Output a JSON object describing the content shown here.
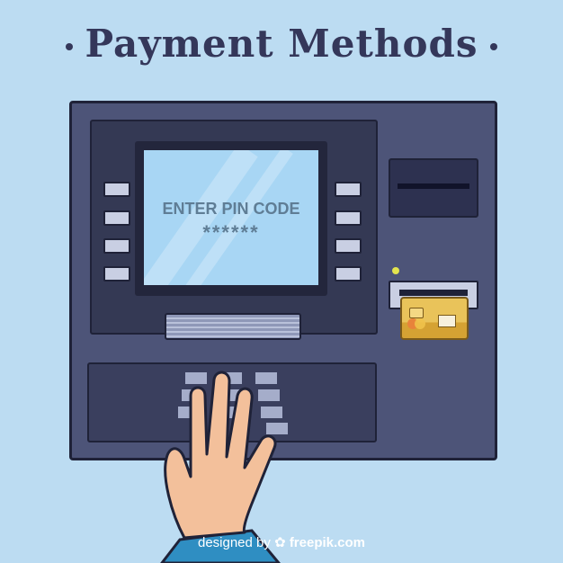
{
  "title": "Payment Methods",
  "screen": {
    "title": "ENTER PIN CODE",
    "pin": "******"
  },
  "credit": {
    "prefix": "designed by",
    "logo_icon": "freepik-icon",
    "brand": "freepik.com"
  },
  "colors": {
    "background": "#bcdcf2",
    "atm_body": "#4d5478",
    "outline": "#1f2238",
    "screen": "#a8d6f4",
    "card": "#e3b441",
    "sleeve": "#2f8ec2",
    "skin": "#f3c09b"
  }
}
